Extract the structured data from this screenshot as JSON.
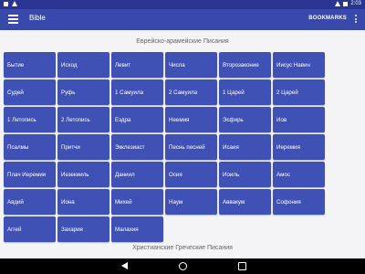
{
  "status_bar": {
    "time": "2:03"
  },
  "app_bar": {
    "title": "Bible",
    "bookmarks_label": "BOOKMARKS"
  },
  "sections": [
    {
      "title": "Еврейско-арамейские Писания",
      "books": [
        "Бытие",
        "Исход",
        "Левит",
        "Числа",
        "Второзаконие",
        "Иисус Навин",
        "Судей",
        "Руфь",
        "1 Самуила",
        "2 Самуила",
        "1 Царей",
        "2 Царей",
        "1 Летопись",
        "2 Летопись",
        "Ездра",
        "Неемия",
        "Эсфирь",
        "Иов",
        "Псалмы",
        "Притчи",
        "Экклезиаст",
        "Песнь песней",
        "Исаия",
        "Иеремия",
        "Плач Иеремии",
        "Иезекииль",
        "Даниил",
        "Осия",
        "Иоиль",
        "Амос",
        "Авдий",
        "Иона",
        "Михей",
        "Наум",
        "Аввакум",
        "Софония",
        "Аггей",
        "Захария",
        "Малахия"
      ]
    },
    {
      "title": "Христианские Греческие Писания"
    }
  ],
  "colors": {
    "status_bar": "#2a3591",
    "app_bar": "#3949ab",
    "tile": "#3f51b5",
    "background": "#f4f4f7"
  }
}
